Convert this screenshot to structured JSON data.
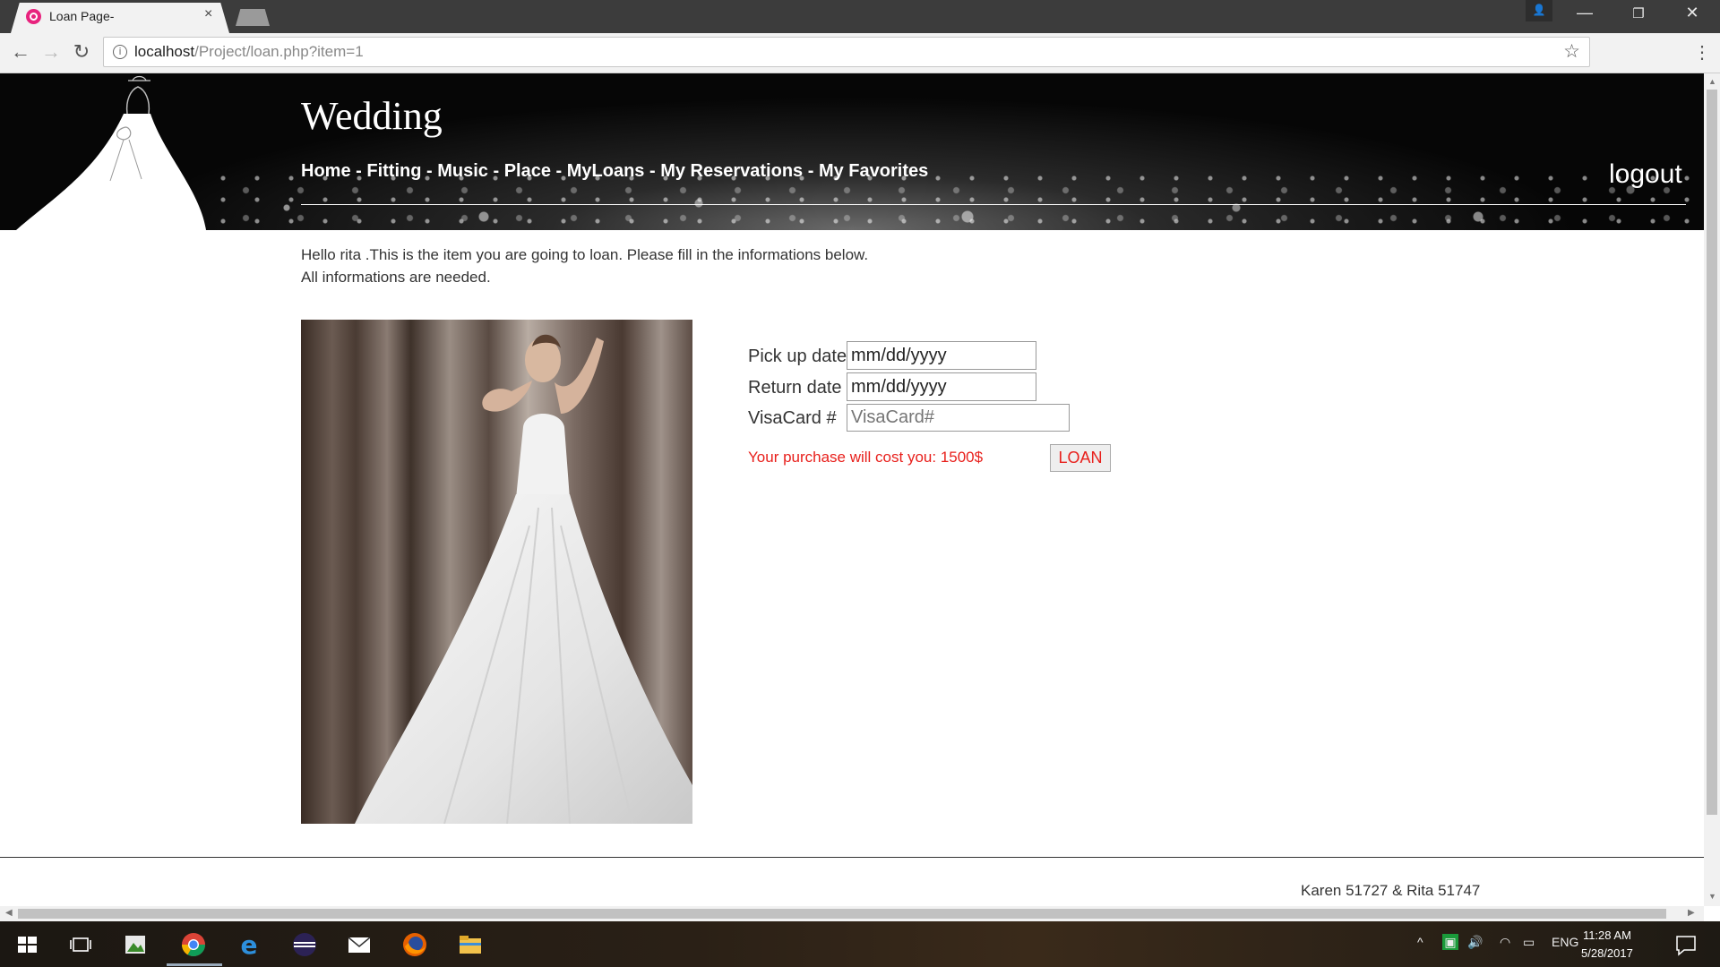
{
  "browser": {
    "tab_title": "Loan Page-",
    "tab_close": "×",
    "url_host": "localhost",
    "url_path": "/Project/loan.php?item=1",
    "back": "←",
    "forward": "→",
    "reload": "↻",
    "bookmark_star": "☆",
    "menu": "⋮",
    "window_min": "—",
    "window_restore": "❐",
    "window_close": "✕",
    "user_icon": "👤"
  },
  "site": {
    "title": "Wedding",
    "nav": [
      "Home",
      "Fitting",
      "Music",
      "Place",
      "MyLoans",
      "My Reservations",
      "My Favorites"
    ],
    "nav_separator": " - ",
    "logout": "logout"
  },
  "content": {
    "greeting_line1": "Hello rita .This is the item you are going to loan. Please fill in the informations below.",
    "greeting_line2": "All informations are needed.",
    "form": {
      "pickup_label": "Pick up date",
      "pickup_value": "mm/dd/yyyy",
      "return_label": "Return date",
      "return_value": "mm/dd/yyyy",
      "visa_label": "VisaCard #",
      "visa_placeholder": "VisaCard#",
      "cost_text": "Your purchase will cost you: 1500$",
      "loan_button": "LOAN"
    },
    "footer": "Karen 51727 & Rita 51747"
  },
  "taskbar": {
    "lang": "ENG",
    "time": "11:28 AM",
    "date": "5/28/2017"
  },
  "colors": {
    "accent_red": "#e8201c",
    "banner_bg": "#050505"
  }
}
